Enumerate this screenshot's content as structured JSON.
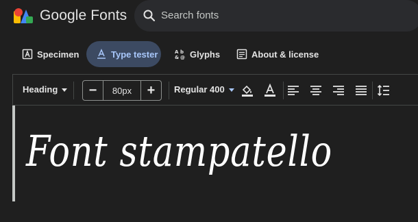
{
  "header": {
    "brand": "Google Fonts",
    "search": {
      "placeholder": "Search fonts",
      "icon": "search-icon"
    },
    "logo_colors": [
      "#4285f4",
      "#ea4335",
      "#fbbc04",
      "#34a853"
    ]
  },
  "tabs": [
    {
      "label": "Specimen",
      "icon": "specimen-icon",
      "active": false
    },
    {
      "label": "Type tester",
      "icon": "type-tester-icon",
      "active": true
    },
    {
      "label": "Glyphs",
      "icon": "glyphs-icon",
      "active": false
    },
    {
      "label": "About & license",
      "icon": "about-icon",
      "active": false
    }
  ],
  "toolbar": {
    "style_select": "Heading",
    "size_minus": "−",
    "size_value": "80px",
    "size_plus": "+",
    "weight_select": "Regular 400",
    "icons": [
      "fill-color-icon",
      "text-color-icon",
      "align-left-icon",
      "align-center-icon",
      "align-right-icon",
      "align-justify-icon",
      "line-height-icon"
    ]
  },
  "preview": {
    "sample_text": "Font stampatello"
  },
  "colors": {
    "background": "#1f1f1f",
    "active_tab_bg": "#3c4a62",
    "active_tab_text": "#a8c7fa",
    "accent": "#a8c7fa"
  }
}
